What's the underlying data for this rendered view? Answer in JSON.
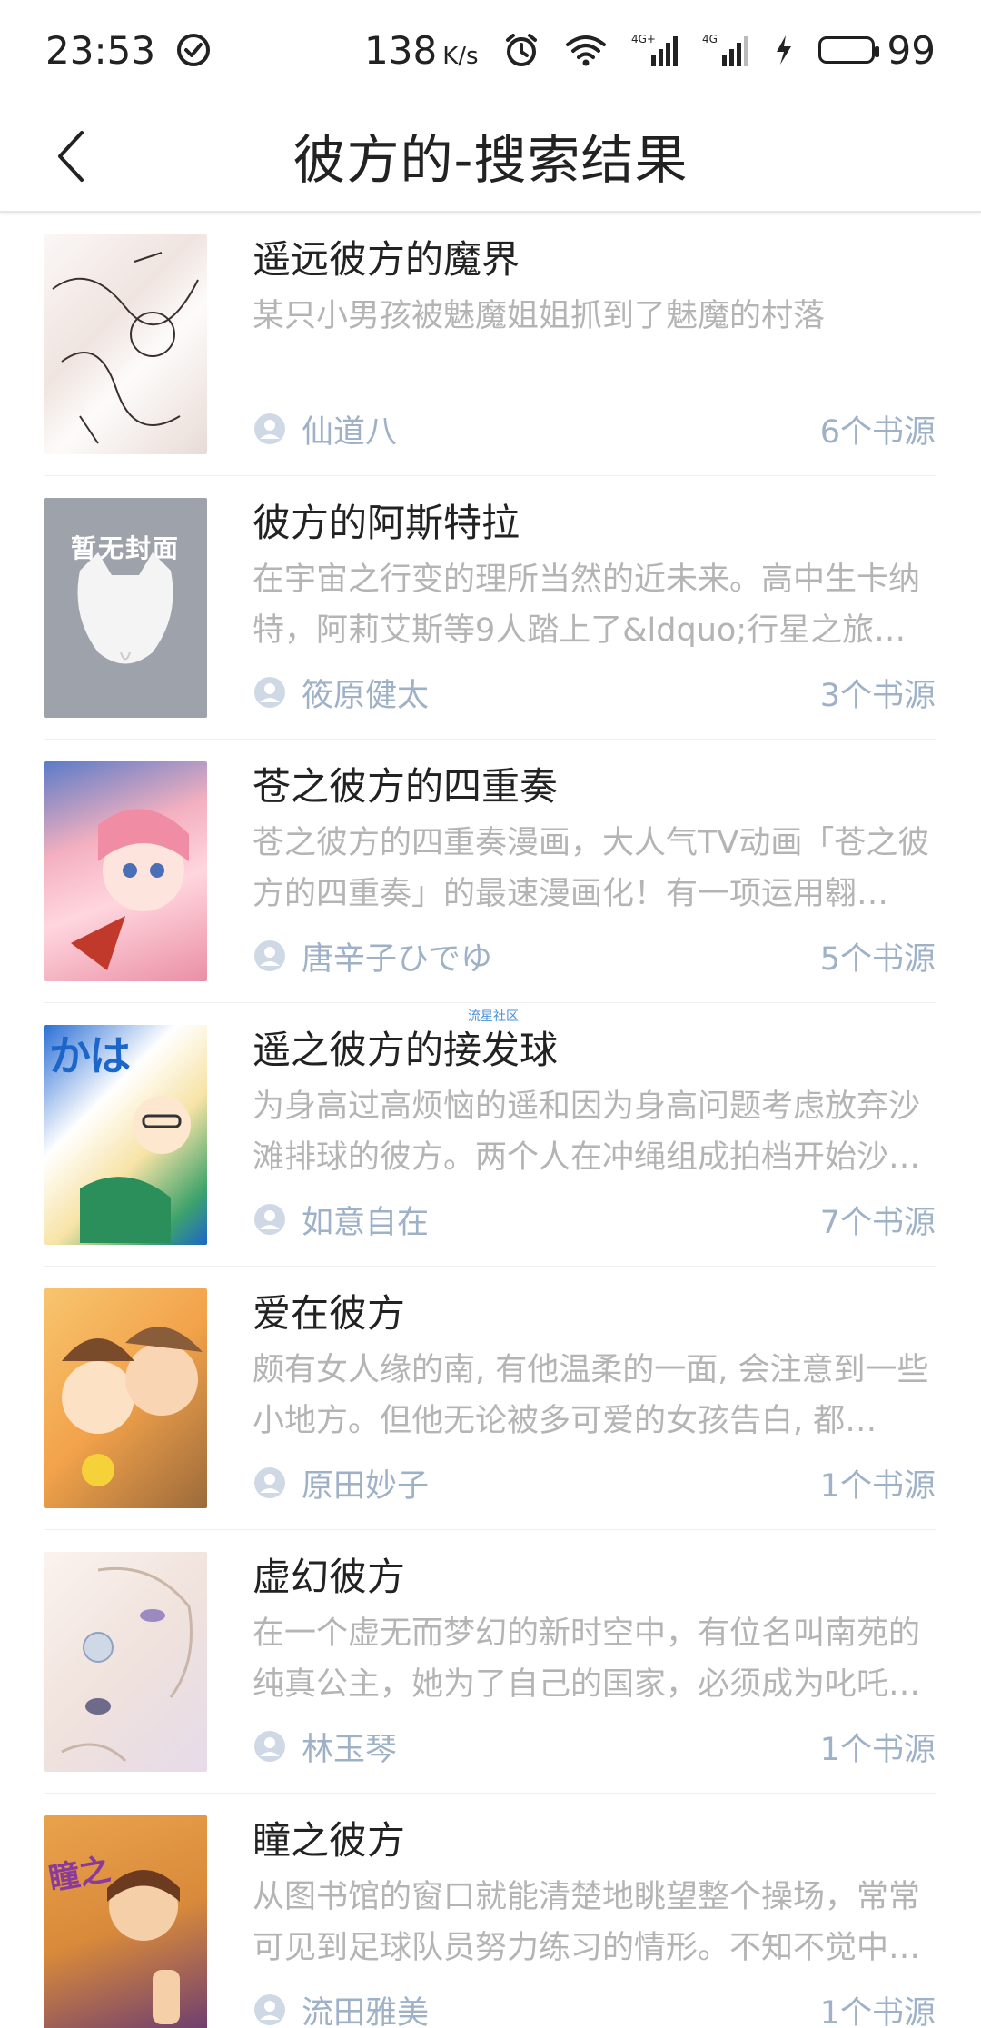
{
  "status_bar": {
    "time": "23:53",
    "net_speed": "138",
    "net_speed_unit": "K/s",
    "battery_level": "99",
    "icons": [
      "check-circle-icon",
      "alarm-icon",
      "wifi-icon",
      "signal-4g-icon",
      "signal-4g-icon",
      "charging-icon",
      "battery-icon"
    ]
  },
  "header": {
    "title": "彼方的-搜索结果"
  },
  "watermark": "流星社区",
  "books": [
    {
      "title": "遥远彼方的魔界",
      "desc": "某只小男孩被魅魔姐姐抓到了魅魔的村落",
      "author": "仙道八",
      "sources": "6个书源",
      "cover_color": "#f5f0ee",
      "cover_accent": "#e6dcd8"
    },
    {
      "title": "彼方的阿斯特拉",
      "desc": "在宇宙之行变的理所当然的近未来。高中生卡纳特，阿莉艾斯等9人踏上了&ldquo;行星之旅…",
      "author": "筱原健太",
      "sources": "3个书源",
      "cover_color": "#9ea3ab",
      "cover_accent": "#f1f1f1",
      "cover_placeholder": "暂无封面"
    },
    {
      "title": "苍之彼方的四重奏",
      "desc": "苍之彼方的四重奏漫画，大人气TV动画「苍之彼方的四重奏」的最速漫画化！有一项运用翱…",
      "author": "唐辛子ひでゆ",
      "sources": "5个书源",
      "cover_color": "#f0a6b4",
      "cover_accent": "#4a6fb7"
    },
    {
      "title": "遥之彼方的接发球",
      "desc": "为身高过高烦恼的遥和因为身高问题考虑放弃沙滩排球的彼方。两个人在冲绳组成拍档开始沙…",
      "author": "如意自在",
      "sources": "7个书源",
      "cover_color": "#f7e3a5",
      "cover_accent": "#1d66c9"
    },
    {
      "title": "爱在彼方",
      "desc": "颇有女人缘的南, 有他温柔的一面, 会注意到一些小地方。但他无论被多可爱的女孩告白, 都…",
      "author": "原田妙子",
      "sources": "1个书源",
      "cover_color": "#f2b25c",
      "cover_accent": "#8a5d3a"
    },
    {
      "title": "虚幻彼方",
      "desc": "在一个虚无而梦幻的新时空中，有位名叫南苑的纯真公主，她为了自己的国家，必须成为叱吒…",
      "author": "林玉琴",
      "sources": "1个书源",
      "cover_color": "#f6ece8",
      "cover_accent": "#c9c0d9"
    },
    {
      "title": "瞳之彼方",
      "desc": "从图书馆的窗口就能清楚地眺望整个操场，常常可见到足球队员努力练习的情形。不知不觉中…",
      "author": "流田雅美",
      "sources": "1个书源",
      "cover_color": "#d98a3a",
      "cover_accent": "#6a3b72"
    }
  ]
}
